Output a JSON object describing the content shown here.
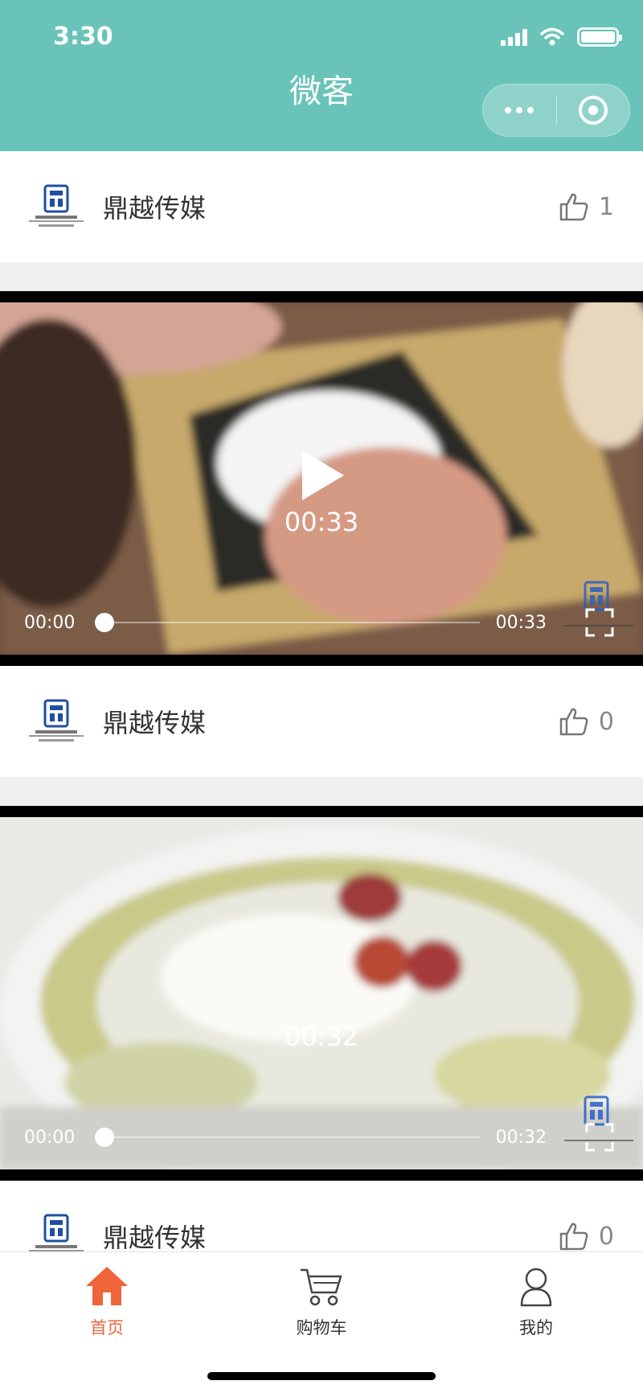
{
  "status_bar": {
    "time": "3:30"
  },
  "header": {
    "title": "微客"
  },
  "posts": [
    {
      "author": "鼎越传媒",
      "likes": "1",
      "video": {
        "current": "00:00",
        "duration": "00:33",
        "center_duration": "00:33",
        "progress": 0
      }
    },
    {
      "author": "鼎越传媒",
      "likes": "0",
      "video": {
        "current": "00:00",
        "duration": "00:32",
        "center_duration": "00:32",
        "progress": 0
      }
    },
    {
      "author": "鼎越传媒",
      "likes": "0"
    }
  ],
  "tabbar": {
    "home": "首页",
    "cart": "购物车",
    "mine": "我的"
  },
  "colors": {
    "header_bg": "#6ac3b9",
    "active_tab": "#f0643c",
    "like_icon": "#888888"
  },
  "icons": [
    "signal-icon",
    "wifi-icon",
    "battery-icon",
    "more-icon",
    "close-capsule-icon",
    "thumbs-up-icon",
    "play-icon",
    "fullscreen-icon",
    "home-icon",
    "cart-icon",
    "user-icon"
  ]
}
